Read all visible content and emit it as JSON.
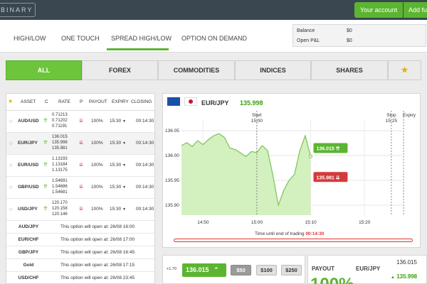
{
  "header": {
    "logo_text": "BINARY",
    "account_label": "Your account",
    "addfunds_label": "Add fu"
  },
  "option_tabs": [
    "HIGH/LOW",
    "ONE TOUCH",
    "SPREAD HIGH/LOW",
    "OPTION ON DEMAND"
  ],
  "active_option_tab": "SPREAD HIGH/LOW",
  "balance": {
    "balance_label": "Balance",
    "balance_value": "$0",
    "pnl_label": "Open P&L",
    "pnl_value": "$0"
  },
  "categories": [
    "ALL",
    "FOREX",
    "COMMODITIES",
    "INDICES",
    "SHARES"
  ],
  "active_category": "ALL",
  "asset_table": {
    "headers": [
      "ASSET",
      "C",
      "RATE",
      "P",
      "PAYOUT",
      "EXPIRY",
      "CLOSING"
    ],
    "rows": [
      {
        "name": "AUD/USD",
        "rates": [
          "0.71213",
          "0.71202",
          "0.71191"
        ],
        "payout": "100%",
        "expiry": "15:30",
        "closing": "00:14:30"
      },
      {
        "name": "EUR/JPY",
        "rates": [
          "136.015",
          "135.998",
          "135.981"
        ],
        "payout": "100%",
        "expiry": "15:30",
        "closing": "00:14:30"
      },
      {
        "name": "EUR/USD",
        "rates": [
          "1.13193",
          "1.13184",
          "1.13175"
        ],
        "payout": "100%",
        "expiry": "15:30",
        "closing": "00:14:30"
      },
      {
        "name": "GBP/USD",
        "rates": [
          "1.54691",
          "1.54686",
          "1.54681"
        ],
        "payout": "100%",
        "expiry": "15:30",
        "closing": "00:14:30"
      },
      {
        "name": "USD/JPY",
        "rates": [
          "120.170",
          "120.158",
          "120.146"
        ],
        "payout": "100%",
        "expiry": "15:30",
        "closing": "00:14:30"
      }
    ],
    "upcoming": [
      {
        "name": "AUD/JPY",
        "message": "This option will open at: 26/08 16:00"
      },
      {
        "name": "EUR/CHF",
        "message": "This option will open at: 26/08 17:00"
      },
      {
        "name": "GBP/JPY",
        "message": "This option will open at: 26/08 16:45"
      },
      {
        "name": "Gold",
        "message": "This option will open at: 26/08 17:15"
      },
      {
        "name": "USD/CHF",
        "message": "This option will open at: 26/08 23:45"
      }
    ]
  },
  "chart": {
    "pair": "EUR/JPY",
    "price": "135.998",
    "start_label": "Start",
    "start_time": "15:00",
    "stop_label": "Stop",
    "stop_time": "15:25",
    "expiry_label": "Expiry",
    "y_ticks": [
      "136.05",
      "136.00",
      "135.95",
      "135.90"
    ],
    "x_ticks": [
      "14:50",
      "15:00",
      "15:10",
      "15:20"
    ],
    "high_price": "136.015",
    "low_price": "135.981",
    "time_end_label": "Time until end of trading",
    "time_end_value": "00:14:30"
  },
  "chart_data": {
    "type": "line",
    "x": [
      "14:46",
      "14:47",
      "14:48",
      "14:49",
      "14:50",
      "14:51",
      "14:52",
      "14:53",
      "14:54",
      "14:55",
      "14:56",
      "14:57",
      "14:58",
      "14:59",
      "15:00",
      "15:01",
      "15:02",
      "15:03",
      "15:04",
      "15:05",
      "15:06",
      "15:07",
      "15:08",
      "15:09",
      "15:10"
    ],
    "values": [
      136.02,
      136.026,
      136.018,
      136.03,
      136.022,
      136.032,
      136.04,
      136.044,
      136.036,
      136.015,
      136.012,
      136.005,
      135.998,
      136.008,
      136.006,
      136.02,
      136.01,
      135.96,
      135.9,
      135.93,
      135.95,
      135.962,
      136.01,
      136.04,
      135.998
    ],
    "ylim": [
      135.88,
      136.07
    ],
    "y_ticks": [
      136.05,
      136.0,
      135.95,
      135.9
    ],
    "x_ticks": [
      "14:50",
      "15:00",
      "15:10",
      "15:20"
    ],
    "xlim": [
      "14:46",
      "15:27"
    ],
    "grid": true,
    "fill": "area under line, light green",
    "start_marker": "15:00",
    "stop_marker": "15:25",
    "upper_price": 136.015,
    "lower_price": 135.981
  },
  "trade": {
    "multiplier": "+1.70",
    "call_price": "136.015",
    "amounts": [
      "$50",
      "$100",
      "$250"
    ],
    "selected_amount": "$50"
  },
  "payout": {
    "label": "PAYOUT",
    "pair": "EUR/JPY",
    "price_top": "136.015",
    "price_current": "135.998",
    "percent": "100%"
  },
  "colors": {
    "green": "#5cb531",
    "red": "#d33b3b",
    "chart_fill": "#d3f0bf",
    "topbar": "#3a4650"
  }
}
